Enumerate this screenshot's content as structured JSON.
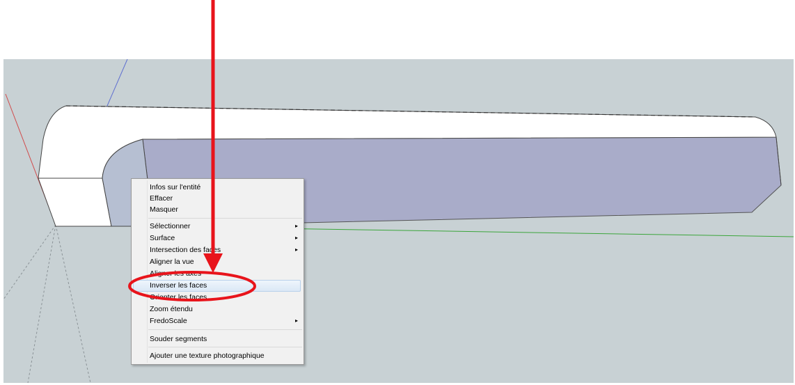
{
  "viewport": {
    "background": "#c8d1d4"
  },
  "model": {
    "top_color": "#ffffff",
    "side_color": "#a9acc9",
    "inner_color": "#b6bfd2"
  },
  "context_menu": {
    "items": [
      {
        "label": "Infos sur l'entité",
        "submenu": false
      },
      {
        "label": "Effacer",
        "submenu": false
      },
      {
        "label": "Masquer",
        "submenu": false
      },
      {
        "label": "Sélectionner",
        "submenu": true
      },
      {
        "label": "Surface",
        "submenu": true
      },
      {
        "label": "Intersection des faces",
        "submenu": true
      },
      {
        "label": "Aligner la vue",
        "submenu": false
      },
      {
        "label": "Aligner les axes",
        "submenu": false
      },
      {
        "label": "Inverser les faces",
        "submenu": false,
        "highlighted": true
      },
      {
        "label": "Orienter les faces",
        "submenu": false
      },
      {
        "label": "Zoom étendu",
        "submenu": false
      },
      {
        "label": "FredoScale",
        "submenu": true
      },
      {
        "label": "Souder segments",
        "submenu": false
      },
      {
        "label": "Ajouter une texture photographique",
        "submenu": false
      }
    ],
    "submenu_glyph": "▸"
  },
  "annotation": {
    "color": "#e8141b"
  }
}
